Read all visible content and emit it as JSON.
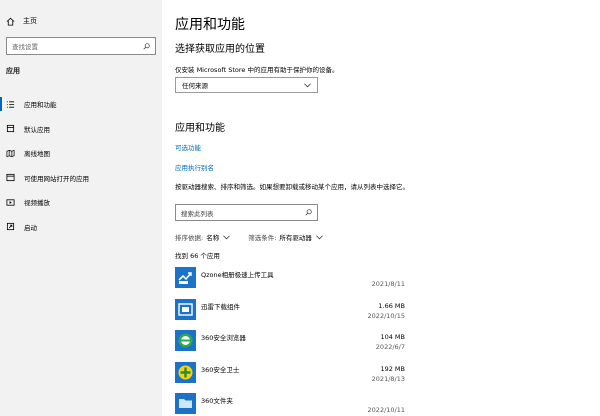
{
  "sidebar": {
    "home_label": "主页",
    "search_placeholder": "查找设置",
    "section": "应用",
    "items": [
      {
        "label": "应用和功能",
        "icon": "apps-list-icon",
        "active": true
      },
      {
        "label": "默认应用",
        "icon": "default-apps-icon"
      },
      {
        "label": "离线地图",
        "icon": "offline-maps-icon"
      },
      {
        "label": "可使用网站打开的应用",
        "icon": "apps-for-websites-icon"
      },
      {
        "label": "视频播放",
        "icon": "video-playback-icon"
      },
      {
        "label": "启动",
        "icon": "startup-icon"
      }
    ]
  },
  "main": {
    "title": "应用和功能",
    "source_title": "选择获取应用的位置",
    "source_desc": "仅安装 Microsoft Store 中的应用有助于保护你的设备。",
    "source_value": "任何来源",
    "apps_title": "应用和功能",
    "link_optional": "可选功能",
    "link_alias": "应用执行别名",
    "search_desc": "按驱动器搜索、排序和筛选。如果想要卸载或移动某个应用，请从列表中选择它。",
    "search_placeholder": "搜索此列表",
    "sort_label": "排序依据:",
    "sort_value": "名称",
    "filter_label": "筛选条件:",
    "filter_value": "所有驱动器",
    "count_text": "找到 66 个应用",
    "apps": [
      {
        "name": "Qzone相册极速上传工具",
        "size": "",
        "date": "2021/8/11",
        "icon": "qzone-upload-icon",
        "color": "#1a73c9"
      },
      {
        "name": "迅雷下载组件",
        "size": "1.66 MB",
        "date": "2022/10/15",
        "icon": "xunlei-icon",
        "color": "#1a73c9"
      },
      {
        "name": "360安全浏览器",
        "size": "104 MB",
        "date": "2022/6/7",
        "icon": "360-browser-icon",
        "color": "#1a73c9"
      },
      {
        "name": "360安全卫士",
        "size": "192 MB",
        "date": "2021/8/13",
        "icon": "360-safe-icon",
        "color": "#1a73c9"
      },
      {
        "name": "360文件夹",
        "size": "",
        "date": "2022/10/11",
        "icon": "360-folder-icon",
        "color": "#1a73c9"
      }
    ]
  }
}
